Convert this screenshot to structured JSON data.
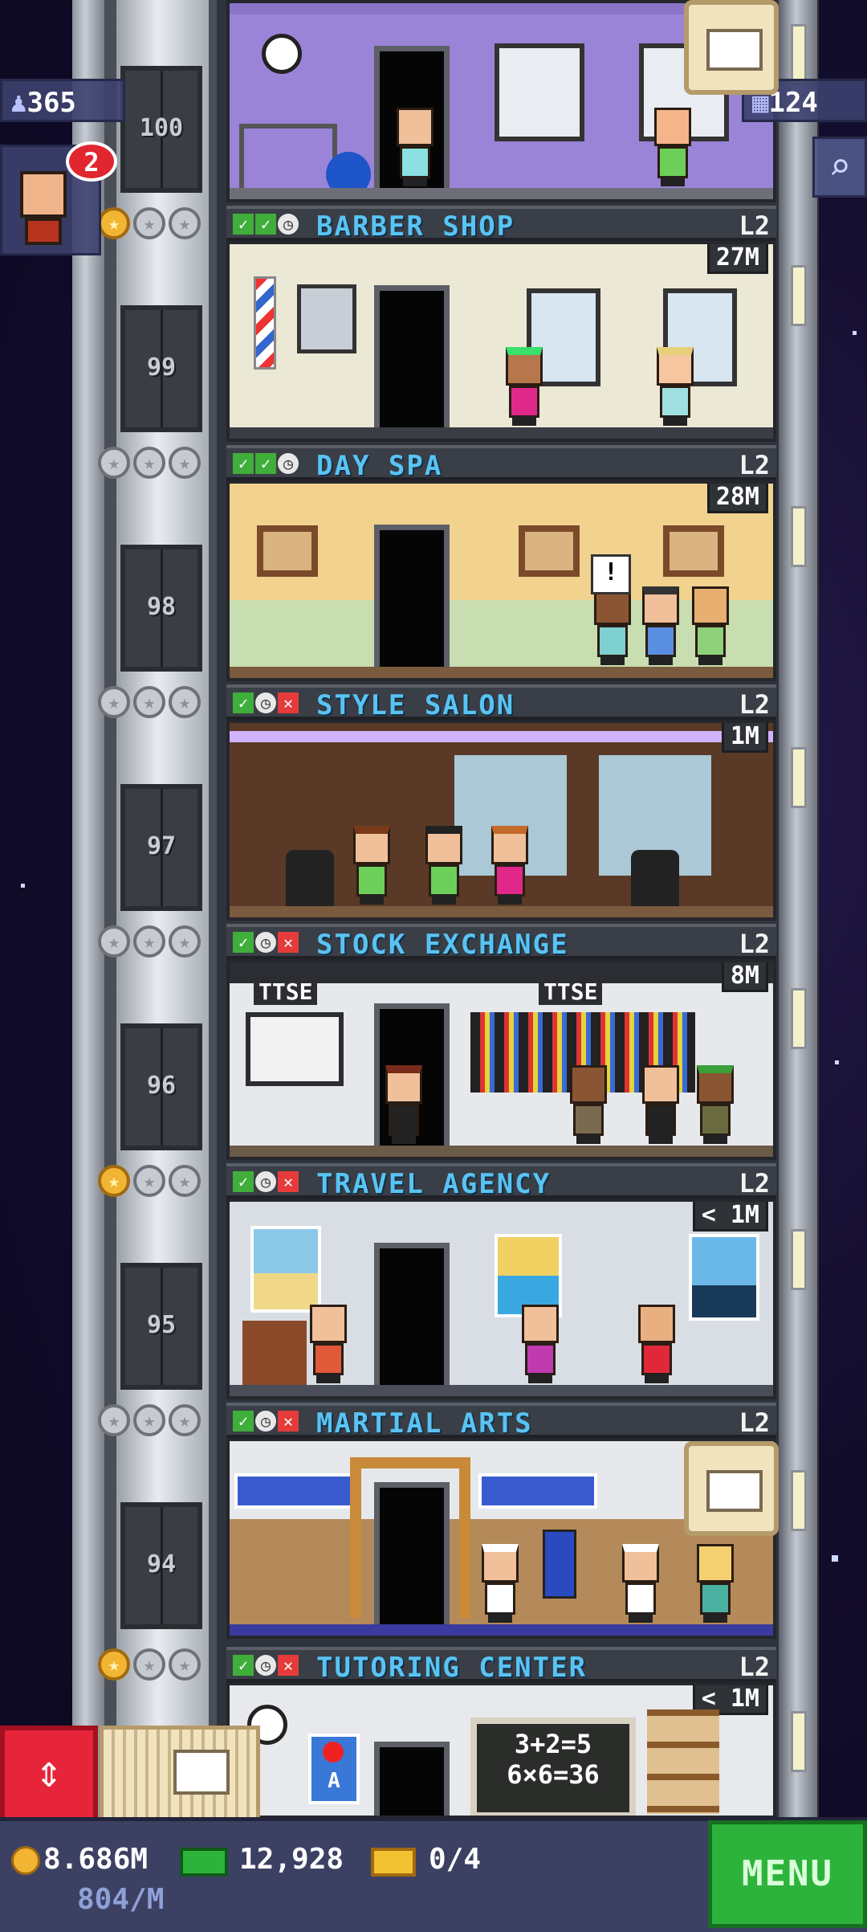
{
  "hud": {
    "population": "365",
    "floors": "124",
    "resident_badge_count": "2"
  },
  "elevator_floors": [
    {
      "number": "100"
    },
    {
      "number": "99"
    },
    {
      "number": "98"
    },
    {
      "number": "97"
    },
    {
      "number": "96"
    },
    {
      "number": "95"
    },
    {
      "number": "94"
    }
  ],
  "floors": [
    {
      "name": "BARBER SHOP",
      "level": "L2",
      "stock": "27M",
      "stars": [
        "gold",
        "silver",
        "silver"
      ],
      "status": [
        "check",
        "check",
        "clock"
      ]
    },
    {
      "name": "DAY SPA",
      "level": "L2",
      "stock": "28M",
      "stars": [
        "silver",
        "silver",
        "silver"
      ],
      "status": [
        "check",
        "check",
        "clock"
      ]
    },
    {
      "name": "STYLE SALON",
      "level": "L2",
      "stock": "1M",
      "stars": [
        "silver",
        "silver",
        "silver"
      ],
      "status": [
        "check",
        "clock",
        "x"
      ]
    },
    {
      "name": "STOCK EXCHANGE",
      "level": "L2",
      "stock": "8M",
      "stars": [
        "silver",
        "silver",
        "silver"
      ],
      "status": [
        "check",
        "clock",
        "x"
      ]
    },
    {
      "name": "TRAVEL AGENCY",
      "level": "L2",
      "stock": "< 1M",
      "stars": [
        "gold",
        "silver",
        "silver"
      ],
      "status": [
        "check",
        "clock",
        "x"
      ]
    },
    {
      "name": "MARTIAL ARTS",
      "level": "L2",
      "stock": "",
      "stars": [
        "silver",
        "silver",
        "silver"
      ],
      "status": [
        "check",
        "clock",
        "x"
      ]
    },
    {
      "name": "TUTORING CENTER",
      "level": "L2",
      "stock": "< 1M",
      "stars": [
        "gold",
        "silver",
        "silver"
      ],
      "status": [
        "check",
        "clock",
        "x"
      ]
    }
  ],
  "signs": {
    "ttse": "TTSE",
    "chalkboard_line1": "3+2=5",
    "chalkboard_line2": "6×6=36",
    "apple_letter": "A"
  },
  "bottom_bar": {
    "coins": "8.686M",
    "coins_rate": "804/M",
    "bux": "12,928",
    "tickets": "0/4",
    "menu_label": "MENU"
  },
  "colors": {
    "business_name": "#59c3f3",
    "menu_green": "#2db33b",
    "alert_red": "#e1262f"
  }
}
